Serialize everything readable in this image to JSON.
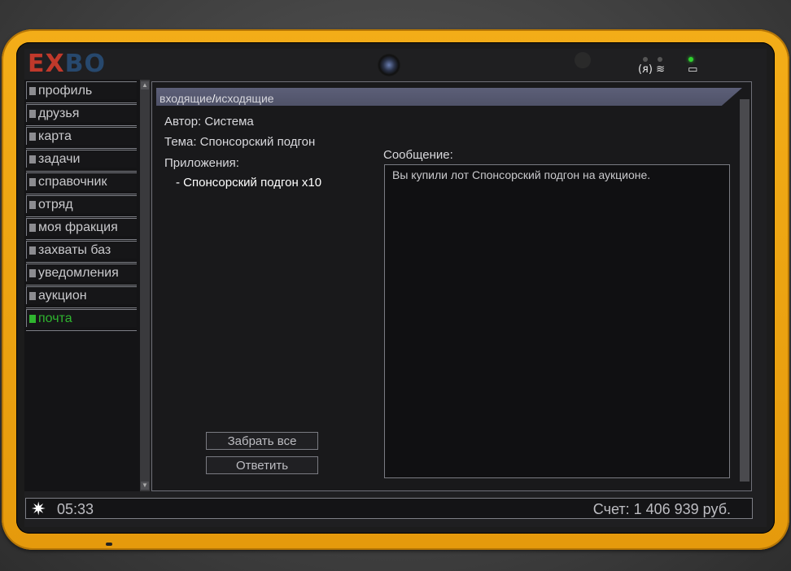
{
  "logo": {
    "part1": "EX",
    "part2": "BO"
  },
  "status_icons": {
    "signal": "(ᴙ)",
    "wifi": "≋",
    "battery": "▭"
  },
  "sidebar": {
    "items": [
      {
        "label": "профиль"
      },
      {
        "label": "друзья"
      },
      {
        "label": "карта"
      },
      {
        "label": "задачи"
      },
      {
        "label": "справочник"
      },
      {
        "label": "отряд"
      },
      {
        "label": "моя фракция"
      },
      {
        "label": "захваты баз"
      },
      {
        "label": "уведомления"
      },
      {
        "label": "аукцион"
      },
      {
        "label": "почта",
        "active": true
      }
    ]
  },
  "tabs": {
    "incoming": "входящие",
    "separator": "/",
    "outgoing": "исходящие"
  },
  "mail": {
    "author": "Автор: Система",
    "subject": "Тема: Спонсорский подгон",
    "attachments_label": "Приложения:",
    "attachment_item": "- Спонсорский подгон x10",
    "message_label": "Сообщение:",
    "message_text": "Вы купили лот Спонсорский подгон на аукционе."
  },
  "buttons": {
    "take_all": "Забрать все",
    "reply": "Ответить"
  },
  "footer": {
    "icon": "sun-icon",
    "time": "05:33",
    "balance": "Счет: 1 406 939 руб."
  },
  "colors": {
    "accent_active": "#2fb52f",
    "bumper": "#f3ad18",
    "tabbar": "#5c5f78"
  }
}
